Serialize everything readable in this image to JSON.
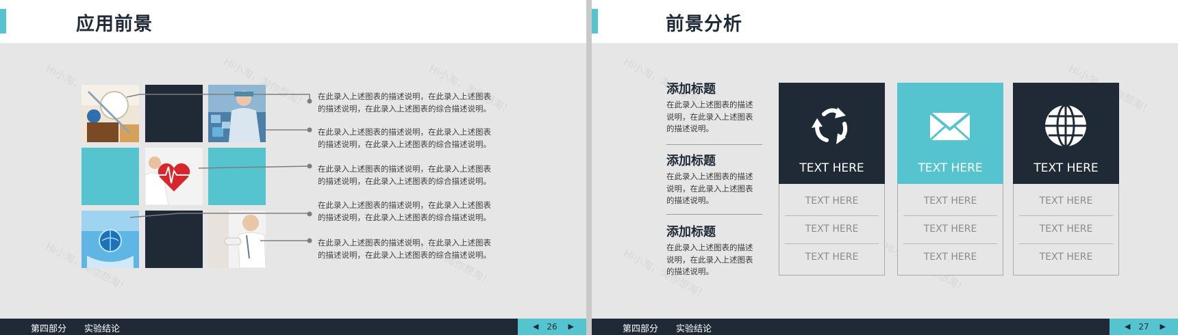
{
  "left": {
    "title": "应用前景",
    "descriptions": [
      [
        "在此录入上述图表的描述说明，在此录入上述图表",
        "的描述说明，在此录入上述图表的综合描述说明。"
      ],
      [
        "在此录入上述图表的描述说明，在此录入上述图表",
        "的描述说明，在此录入上述图表的综合描述说明。"
      ],
      [
        "在此录入上述图表的描述说明，在此录入上述图表",
        "的描述说明，在此录入上述图表的综合描述说明。"
      ],
      [
        "在此录入上述图表的描述说明，在此录入上述图表",
        "的描述说明，在此录入上述图表的综合描述说明。"
      ],
      [
        "在此录入上述图表的描述说明，在此录入上述图表",
        "的描述说明，在此录入上述图表的综合描述说明。"
      ]
    ],
    "footer": {
      "section": "第四部分",
      "subtitle": "实验结论",
      "page": "26",
      "prev": "◀",
      "next": "▶"
    }
  },
  "right": {
    "title": "前景分析",
    "items": [
      {
        "heading": "添加标题",
        "lines": [
          "在此录入上述图表的描述",
          "说明，在此录入上述图表",
          "的描述说明。"
        ]
      },
      {
        "heading": "添加标题",
        "lines": [
          "在此录入上述图表的描述",
          "说明，在此录入上述图表",
          "的描述说明。"
        ]
      },
      {
        "heading": "添加标题",
        "lines": [
          "在此录入上述图表的描述",
          "说明，在此录入上述图表",
          "的描述说明。"
        ]
      }
    ],
    "cards": [
      {
        "icon": "recycle-icon",
        "title": "TEXT HERE",
        "rows": [
          "TEXT HERE",
          "TEXT HERE",
          "TEXT HERE"
        ]
      },
      {
        "icon": "envelope-icon",
        "title": "TEXT HERE",
        "rows": [
          "TEXT HERE",
          "TEXT HERE",
          "TEXT HERE"
        ]
      },
      {
        "icon": "globe-icon",
        "title": "TEXT HERE",
        "rows": [
          "TEXT HERE",
          "TEXT HERE",
          "TEXT HERE"
        ]
      }
    ],
    "footer": {
      "section": "第四部分",
      "subtitle": "实验结论",
      "page": "27",
      "prev": "◀",
      "next": "▶"
    }
  },
  "watermark": "Hi小淘，淘你想淘！",
  "colors": {
    "accent": "#56c4cf",
    "dark": "#1f2a36",
    "background": "#e6e6e6"
  }
}
